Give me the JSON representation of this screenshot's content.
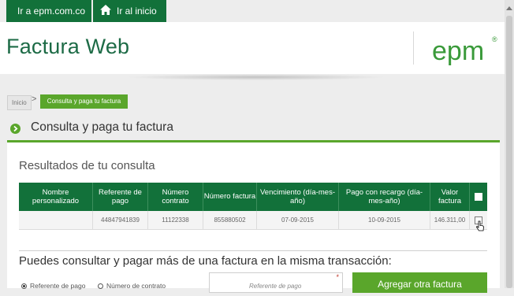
{
  "topbar": {
    "link_label": "Ir a epm.com.co",
    "home_label": "Ir al inicio"
  },
  "header": {
    "app_title": "Factura Web",
    "logo_text": "epm",
    "logo_mark": "®"
  },
  "breadcrumb": {
    "home": "Inicio",
    "separator": ">",
    "current": "Consulta y paga tu factura"
  },
  "section": {
    "title": "Consulta y paga tu factura"
  },
  "results": {
    "title": "Resultados de tu consulta",
    "columns": [
      "Nombre personalizado",
      "Referente de pago",
      "Número contrato",
      "Número factura",
      "Vencimiento (día-mes-año)",
      "Pago con recargo (día-mes-año)",
      "Valor factura"
    ],
    "rows": [
      {
        "nombre": "",
        "referente": "44847941839",
        "contrato": "11122338",
        "factura": "855880502",
        "vencimiento": "07-09-2015",
        "recargo": "10-09-2015",
        "valor": "146.311,00"
      }
    ]
  },
  "multi": {
    "text": "Puedes consultar y pagar más de una factura en la misma transacción:",
    "radio_referente": "Referente de pago",
    "radio_contrato": "Número de contrato",
    "input_placeholder": "Referente de pago",
    "required_mark": "*",
    "add_button": "Agregar otra factura"
  },
  "colors": {
    "dark_green": "#12713a",
    "light_green": "#5aa62b"
  }
}
